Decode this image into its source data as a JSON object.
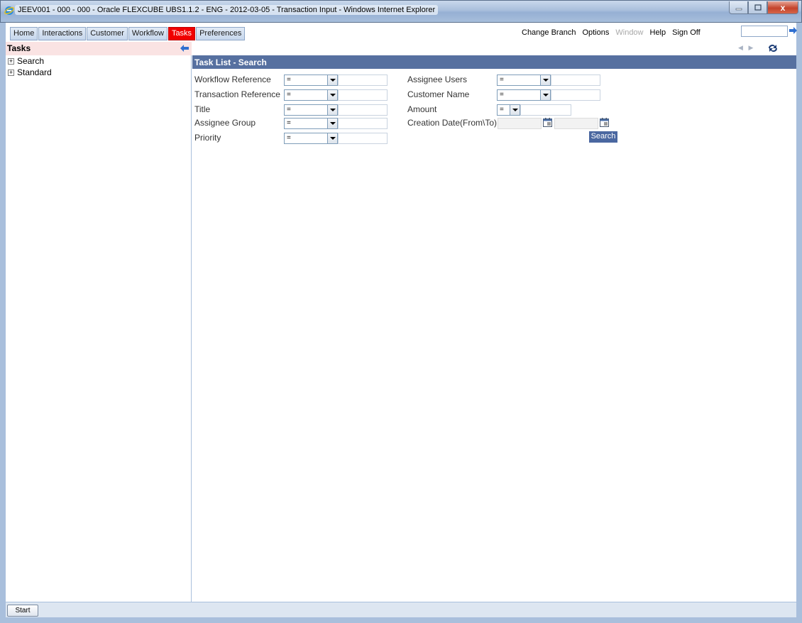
{
  "window": {
    "title": "JEEV001 - 000 - 000 - Oracle FLEXCUBE UBS1.1.2 - ENG - 2012-03-05 - Transaction Input - Windows Internet Explorer",
    "close_glyph": "x"
  },
  "menu": {
    "tabs": [
      {
        "label": "Home"
      },
      {
        "label": "Interactions"
      },
      {
        "label": "Customer"
      },
      {
        "label": "Workflow"
      },
      {
        "label": "Tasks",
        "active": true
      },
      {
        "label": "Preferences"
      }
    ],
    "links": {
      "change_branch": "Change Branch",
      "options": "Options",
      "window": "Window",
      "help": "Help",
      "sign_off": "Sign Off"
    },
    "quick_input_value": ""
  },
  "nav": {
    "back_glyph": "◀",
    "forward_glyph": "▶"
  },
  "sidebar": {
    "title": "Tasks",
    "items": [
      {
        "label": "Search"
      },
      {
        "label": "Standard"
      }
    ]
  },
  "task_search": {
    "section_title": "Task List - Search",
    "fields": {
      "workflow_reference": {
        "label": "Workflow Reference",
        "operator": "=",
        "value": ""
      },
      "transaction_reference": {
        "label": "Transaction Reference",
        "operator": "=",
        "value": ""
      },
      "title": {
        "label": "Title",
        "operator": "=",
        "value": ""
      },
      "assignee_group": {
        "label": "Assignee Group",
        "operator": "=",
        "value": ""
      },
      "priority": {
        "label": "Priority",
        "operator": "=",
        "value": ""
      },
      "assignee_users": {
        "label": "Assignee Users",
        "operator": "=",
        "value": ""
      },
      "customer_name": {
        "label": "Customer Name",
        "operator": "=",
        "value": ""
      },
      "amount": {
        "label": "Amount",
        "operator": "=",
        "value": ""
      },
      "creation_date": {
        "label": "Creation Date(From\\To)",
        "from": "",
        "to": ""
      }
    },
    "search_label": "Search"
  },
  "statusbar": {
    "start_label": "Start"
  },
  "colors": {
    "active_tab": "#f00000",
    "section_header": "#5670a0",
    "sidebar_header": "#fae3e3"
  }
}
